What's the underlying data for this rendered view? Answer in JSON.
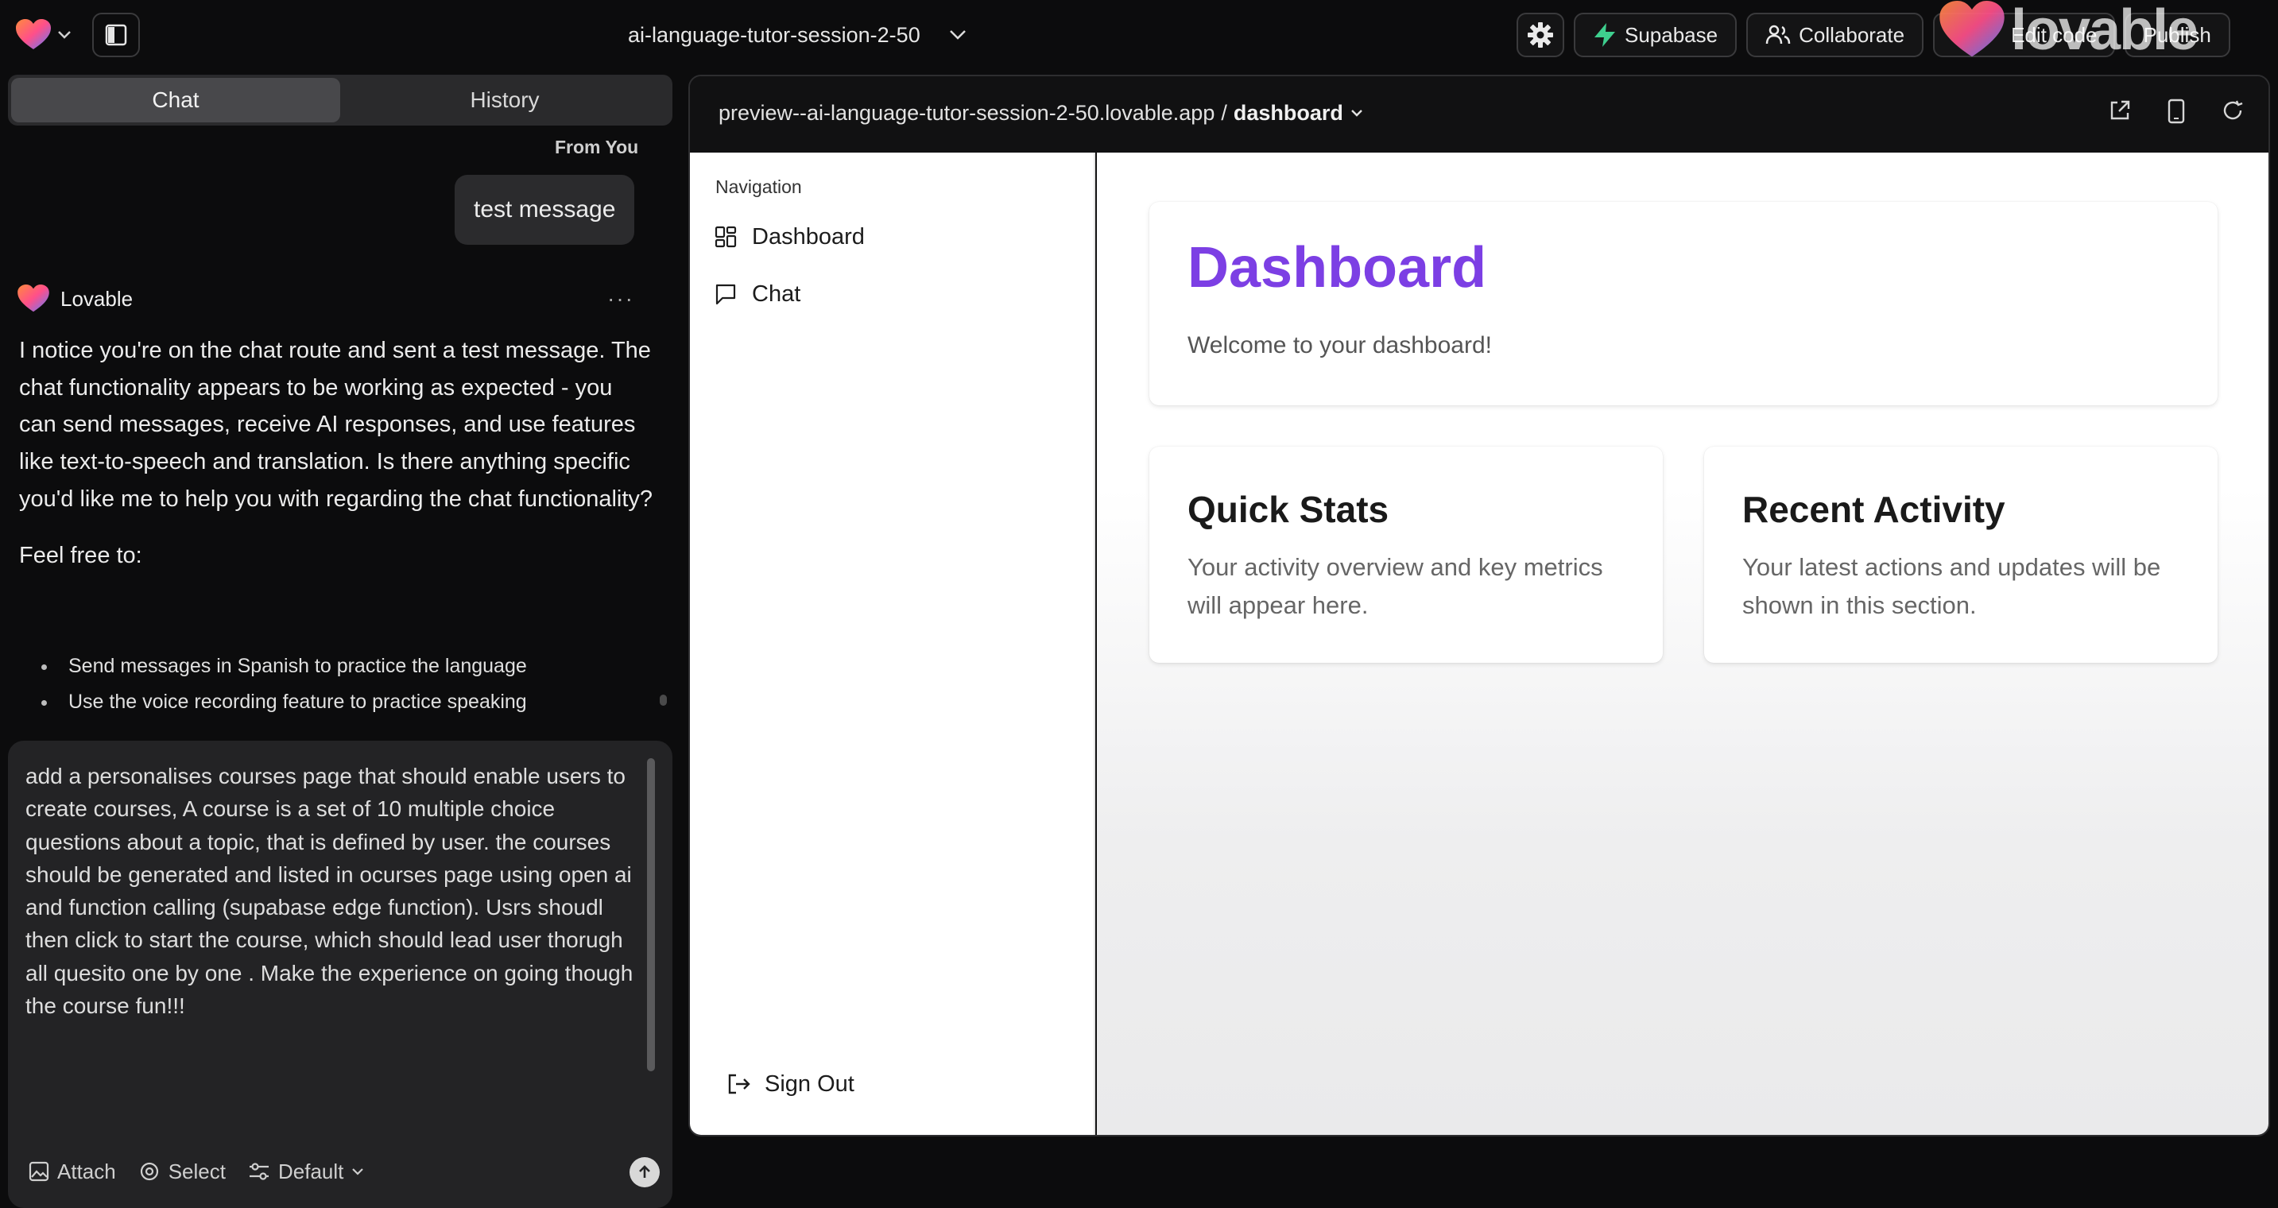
{
  "topbar": {
    "project_name": "ai-language-tutor-session-2-50",
    "buttons": {
      "supabase": "Supabase",
      "collaborate": "Collaborate",
      "edit": "Edit code",
      "publish": "Publish"
    },
    "brand_overlay": "lovable"
  },
  "chat_panel": {
    "tabs": [
      "Chat",
      "History"
    ],
    "active_tab": "Chat",
    "user_label": "From You",
    "user_message": "test message",
    "assistant_name": "Lovable",
    "assistant_paragraph_1": "I notice you're on the chat route and sent a test message. The chat functionality appears to be working as expected - you can send messages, receive AI responses, and use features like text-to-speech and translation. Is there anything specific you'd like me to help you with regarding the chat functionality?",
    "assistant_paragraph_2": "Feel free to:",
    "bullets": [
      "Send messages in Spanish to practice the language",
      "Use the voice recording feature to practice speaking"
    ],
    "composer": {
      "value": "add a personalises courses page that should enable users to create courses, A course is a set of 10 multiple choice questions about a topic, that is defined by user. the courses should be generated and listed in ocurses page using open ai and function calling (supabase edge function). Usrs shoudl then click to start the course, which should lead user thorugh all quesito one by one . Make the experience on going though the course fun!!!",
      "tools": {
        "attach": "Attach",
        "select": "Select",
        "mode": "Default"
      }
    }
  },
  "preview": {
    "url": "preview--ai-language-tutor-session-2-50.lovable.app",
    "separator": "/",
    "route": "dashboard",
    "app": {
      "nav_heading": "Navigation",
      "nav_items": [
        "Dashboard",
        "Chat"
      ],
      "sign_out": "Sign Out",
      "dashboard_title": "Dashboard",
      "dashboard_welcome": "Welcome to your dashboard!",
      "cards": [
        {
          "title": "Quick Stats",
          "text": "Your activity overview and key metrics will appear here."
        },
        {
          "title": "Recent Activity",
          "text": "Your latest actions and updates will be shown in this section."
        }
      ]
    }
  },
  "colors": {
    "accent_purple": "#7c3fe4",
    "supabase_green": "#3ecf8e",
    "background_dark": "#0c0c0d"
  }
}
